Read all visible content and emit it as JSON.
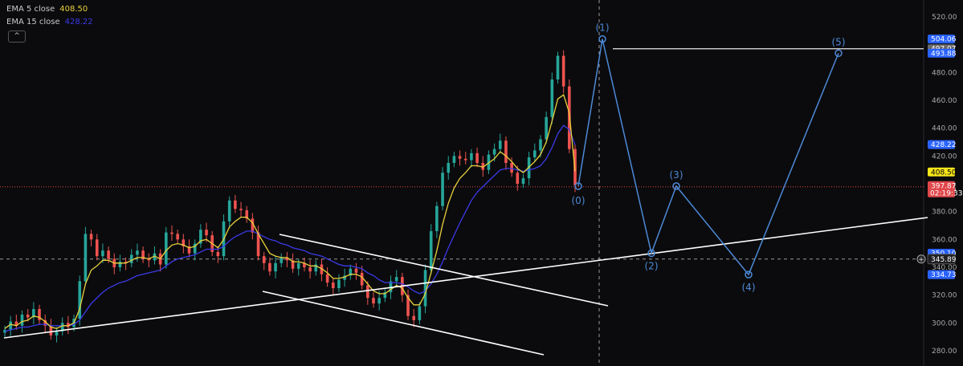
{
  "legend": {
    "ema5_label": "EMA 5 close",
    "ema5_value": "408.50",
    "ema15_label": "EMA 15 close",
    "ema15_value": "428.22",
    "collapse_symbol": "^"
  },
  "colors": {
    "background": "#0b0b0d",
    "ema5": "#e7d13c",
    "ema15": "#3a3ae8",
    "wave": "#4d89d6",
    "up_candle": "#26a69a",
    "down_candle": "#ef5350",
    "trendline": "#ffffff",
    "price_line": "#e0474b"
  },
  "chart_data": {
    "type": "line",
    "y_axis": {
      "min": 280,
      "max": 520,
      "ticks": [
        "520.00",
        "480.00",
        "460.00",
        "440.00",
        "420.00",
        "380.00",
        "360.00",
        "340.00",
        "320.00",
        "300.00",
        "280.00"
      ]
    },
    "price_badges": [
      {
        "text": "504.06",
        "value": 504.06,
        "bg": "#2962ff",
        "fg": "#ffffff"
      },
      {
        "text": "497.07",
        "value": 497.07,
        "bg": "#6b6b6b",
        "fg": "#ffffff"
      },
      {
        "text": "493.88",
        "value": 493.88,
        "bg": "#2962ff",
        "fg": "#ffffff"
      },
      {
        "text": "428.22",
        "value": 428.22,
        "bg": "#2962ff",
        "fg": "#ffffff"
      },
      {
        "text": "408.50",
        "value": 408.5,
        "bg": "#f5e51b",
        "fg": "#000000"
      },
      {
        "text": "398.32",
        "value": 398.32,
        "bg": "#2962ff",
        "fg": "#ffffff"
      },
      {
        "text": "395.86",
        "value": 395.86,
        "bg": "#2962ff",
        "fg": "#ffffff"
      },
      {
        "text": "350.10",
        "value": 350.1,
        "bg": "#2962ff",
        "fg": "#ffffff"
      },
      {
        "text": "334.73",
        "value": 334.73,
        "bg": "#2962ff",
        "fg": "#ffffff"
      }
    ],
    "last_price": {
      "value": 397.87,
      "text": "397.87",
      "countdown": "02:19:33"
    },
    "crosshair": {
      "value": 345.89,
      "text": "345.89"
    },
    "close_series": [
      295,
      301,
      298,
      306,
      304,
      310,
      302,
      298,
      291,
      294,
      300,
      297,
      303,
      330,
      364,
      360,
      348,
      352,
      346,
      340,
      344,
      343,
      349,
      352,
      346,
      345,
      350,
      342,
      365,
      364,
      360,
      355,
      350,
      357,
      367,
      363,
      351,
      348,
      373,
      388,
      382,
      381,
      375,
      365,
      348,
      343,
      337,
      343,
      347,
      345,
      339,
      343,
      340,
      337,
      342,
      335,
      329,
      325,
      331,
      334,
      339,
      336,
      327,
      318,
      314,
      318,
      322,
      330,
      333,
      320,
      305,
      302,
      312,
      338,
      366,
      384,
      408,
      415,
      420,
      418,
      417,
      422,
      415,
      410,
      421,
      425,
      431,
      415,
      408,
      400,
      404,
      419,
      424,
      432,
      448,
      475,
      492,
      470,
      425,
      399
    ],
    "ema5_series": [
      296,
      299,
      298,
      301,
      302,
      305,
      304,
      301,
      297,
      296,
      298,
      298,
      300,
      310,
      328,
      338,
      341,
      345,
      345,
      343,
      343,
      343,
      345,
      347,
      347,
      346,
      348,
      346,
      352,
      356,
      357,
      356,
      354,
      355,
      359,
      360,
      357,
      354,
      360,
      369,
      373,
      376,
      376,
      372,
      364,
      357,
      350,
      348,
      347,
      347,
      344,
      344,
      343,
      341,
      341,
      339,
      336,
      332,
      332,
      333,
      335,
      335,
      333,
      328,
      323,
      321,
      321,
      324,
      327,
      325,
      318,
      313,
      313,
      321,
      336,
      352,
      371,
      386,
      397,
      404,
      408,
      413,
      413,
      412,
      415,
      418,
      423,
      420,
      416,
      411,
      408,
      412,
      416,
      421,
      430,
      445,
      461,
      464,
      451,
      409
    ],
    "ema15_series": [
      294,
      295,
      296,
      297,
      297,
      298,
      299,
      299,
      298,
      298,
      298,
      298,
      299,
      302,
      308,
      314,
      318,
      322,
      325,
      327,
      329,
      330,
      332,
      334,
      335,
      336,
      337,
      338,
      341,
      344,
      346,
      347,
      348,
      349,
      351,
      353,
      353,
      353,
      355,
      359,
      362,
      364,
      366,
      366,
      364,
      362,
      360,
      359,
      357,
      356,
      354,
      353,
      352,
      350,
      349,
      348,
      346,
      344,
      342,
      341,
      341,
      340,
      339,
      336,
      334,
      331,
      329,
      329,
      329,
      328,
      326,
      323,
      321,
      323,
      328,
      335,
      344,
      354,
      363,
      372,
      380,
      388,
      394,
      398,
      402,
      406,
      410,
      411,
      411,
      410,
      409,
      410,
      411,
      413,
      418,
      426,
      436,
      442,
      439,
      428
    ],
    "elliott_wave": [
      {
        "label": "(0)",
        "value": 398.32
      },
      {
        "label": "(1)",
        "value": 504.06
      },
      {
        "label": "(2)",
        "value": 350.1
      },
      {
        "label": "(3)",
        "value": 398.32
      },
      {
        "label": "(4)",
        "value": 334.73
      },
      {
        "label": "(5)",
        "value": 493.88
      }
    ],
    "horizontal_level": 497.07,
    "grid": false
  }
}
